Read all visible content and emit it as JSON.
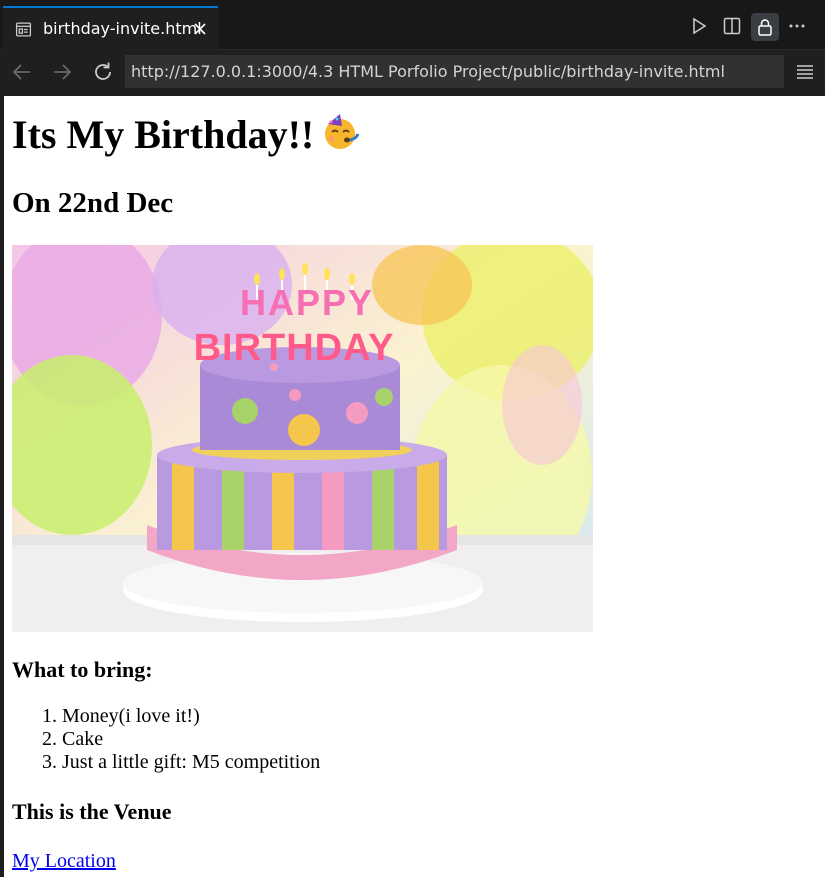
{
  "tab": {
    "title": "birthday-invite.html"
  },
  "nav": {
    "url": "http://127.0.0.1:3000/4.3 HTML Porfolio Project/public/birthday-invite.html"
  },
  "page": {
    "heading": "Its My Birthday!!",
    "date_heading": "On 22nd Dec",
    "cake_text_top": "HAPPY",
    "cake_text_bottom": "BIRTHDAY",
    "bring_heading": "What to bring:",
    "bring_items": [
      "Money(i love it!)",
      "Cake",
      "Just a little gift: M5 competition"
    ],
    "venue_heading": "This is the Venue",
    "location_link": "My Location"
  },
  "icons": {
    "tab": "browser-preview-icon",
    "close": "close-icon",
    "run": "play-icon",
    "split": "split-editor-icon",
    "lock": "lock-icon",
    "more": "more-icon",
    "back": "arrow-left-icon",
    "forward": "arrow-right-icon",
    "reload": "reload-icon",
    "menu": "menu-icon",
    "emoji": "party-face-emoji"
  },
  "colors": {
    "accent": "#0078d4",
    "link": "#0000ee"
  }
}
